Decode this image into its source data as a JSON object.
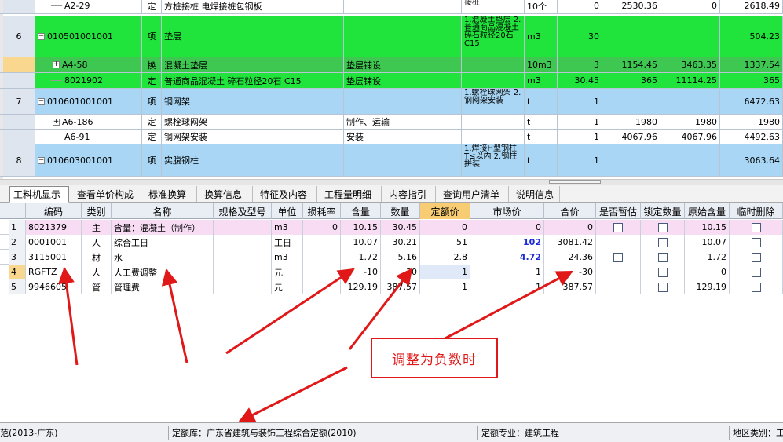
{
  "top_grid": {
    "rows": [
      {
        "num": "",
        "code": "A2-29",
        "type": "定",
        "name": "方桩接桩 电焊接桩包钢板",
        "feature": "",
        "content": "接桩",
        "unit": "10个",
        "qty": "0",
        "price": "2530.36",
        "total": "0",
        "last": "2618.49",
        "color": "#ffffff",
        "tree": "line"
      },
      {
        "num": "6",
        "code": "010501001001",
        "type": "项",
        "name": "垫层",
        "feature": "",
        "content": "1.混凝土垫层 2.普通商品混凝土 碎石粒径20石 C15",
        "unit": "m3",
        "qty": "30",
        "price": "",
        "total": "",
        "last": "504.23",
        "color": "#20e43c",
        "tree": "minus"
      },
      {
        "num": "",
        "code": "A4-58",
        "type": "换",
        "name": "混凝土垫层",
        "feature": "垫层铺设",
        "content": "",
        "unit": "10m3",
        "qty": "3",
        "price": "1154.45",
        "total": "3463.35",
        "last": "1337.54",
        "color": "#3ec852",
        "tree": "plus"
      },
      {
        "num": "",
        "code": "8021902",
        "type": "定",
        "name": "普通商品混凝土 碎石粒径20石 C15",
        "feature": "垫层铺设",
        "content": "",
        "unit": "m3",
        "qty": "30.45",
        "price": "365",
        "total": "11114.25",
        "last": "365",
        "color": "#20e43c",
        "tree": "line"
      },
      {
        "num": "7",
        "code": "010601001001",
        "type": "项",
        "name": "钢网架",
        "feature": "",
        "content": "1.螺栓球网架 2.钢网架安装",
        "unit": "t",
        "qty": "1",
        "price": "",
        "total": "",
        "last": "6472.63",
        "color": "#a8d6f4",
        "tree": "minus"
      },
      {
        "num": "",
        "code": "A6-186",
        "type": "定",
        "name": "螺栓球网架",
        "feature": "制作、运输",
        "content": "",
        "unit": "t",
        "qty": "1",
        "price": "1980",
        "total": "1980",
        "last": "1980",
        "color": "#ffffff",
        "tree": "plus"
      },
      {
        "num": "",
        "code": "A6-91",
        "type": "定",
        "name": "钢网架安装",
        "feature": "安装",
        "content": "",
        "unit": "t",
        "qty": "1",
        "price": "4067.96",
        "total": "4067.96",
        "last": "4492.63",
        "color": "#ffffff",
        "tree": "line"
      },
      {
        "num": "8",
        "code": "010603001001",
        "type": "项",
        "name": "实腹钢柱",
        "feature": "",
        "content": "1.焊接H型钢柱 T≤以内 2.钢柱拼装",
        "unit": "t",
        "qty": "1",
        "price": "",
        "total": "",
        "last": "3063.64",
        "color": "#a8d6f4",
        "tree": "minus"
      }
    ]
  },
  "tabs": [
    "工料机显示",
    "查看单价构成",
    "标准换算",
    "换算信息",
    "特征及内容",
    "工程量明细",
    "内容指引",
    "查询用户清单",
    "说明信息"
  ],
  "bottom_grid": {
    "headers": [
      "",
      "编码",
      "类别",
      "名称",
      "规格及型号",
      "单位",
      "损耗率",
      "含量",
      "数量",
      "定额价",
      "市场价",
      "合价",
      "是否暂估",
      "锁定数量",
      "原始含量",
      "临时删除"
    ],
    "rows": [
      {
        "n": "1",
        "code": "8021379",
        "cat": "主",
        "name": "含量：混凝土（制作）",
        "spec": "",
        "unit": "m3",
        "loss": "0",
        "content": "10.15",
        "qty": "30.45",
        "quota": "0",
        "market": "0",
        "total": "0",
        "est": false,
        "lock": true,
        "orig": "10.15",
        "del": true,
        "bg": "#f7dcf4"
      },
      {
        "n": "2",
        "code": "0001001",
        "cat": "人",
        "name": "综合工日",
        "spec": "",
        "unit": "工日",
        "loss": "",
        "content": "10.07",
        "qty": "30.21",
        "quota": "51",
        "market": "102",
        "total": "3081.42",
        "est": null,
        "lock": true,
        "orig": "10.07",
        "del": true,
        "bg": "#ffffff"
      },
      {
        "n": "3",
        "code": "3115001",
        "cat": "材",
        "name": "水",
        "spec": "",
        "unit": "m3",
        "loss": "",
        "content": "1.72",
        "qty": "5.16",
        "quota": "2.8",
        "market": "4.72",
        "total": "24.36",
        "est": true,
        "lock": true,
        "orig": "1.72",
        "del": true,
        "bg": "#ffffff"
      },
      {
        "n": "4",
        "code": "RGFTZ",
        "cat": "人",
        "name": "人工费调整",
        "spec": "",
        "unit": "元",
        "loss": "",
        "content": "-10",
        "qty": "-30",
        "quota": "1",
        "market": "1",
        "total": "-30",
        "est": null,
        "lock": true,
        "orig": "0",
        "del": true,
        "bg": "#ffffff"
      },
      {
        "n": "5",
        "code": "9946605",
        "cat": "管",
        "name": "管理费",
        "spec": "",
        "unit": "元",
        "loss": "",
        "content": "129.19",
        "qty": "387.57",
        "quota": "1",
        "market": "1",
        "total": "387.57",
        "est": null,
        "lock": true,
        "orig": "129.19",
        "del": true,
        "bg": "#ffffff"
      }
    ]
  },
  "annotation": {
    "callout_text": "调整为负数时",
    "color": "#e01818"
  },
  "status_bar": {
    "std": "范(2013-广东)",
    "quota_lib": "定额库：广东省建筑与装饰工程综合定额(2010)",
    "quota_major": "定额专业：建筑工程",
    "region": "地区类别：工"
  },
  "colors": {
    "green_row": "#20e43c",
    "blue_row": "#a8d6f4",
    "selected_header": "#f8cc72"
  }
}
